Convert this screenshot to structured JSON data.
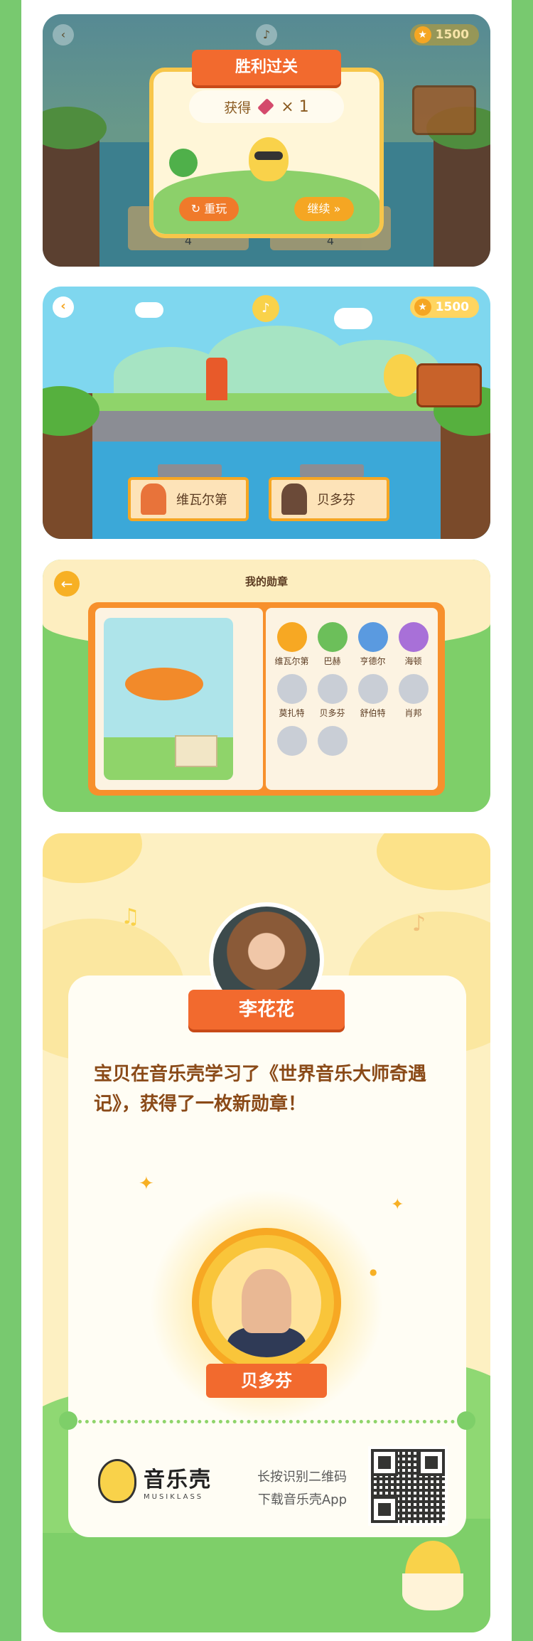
{
  "colors": {
    "page_green": "#78c96f",
    "accent_orange": "#f26a2e",
    "accent_yellow": "#f9d24a",
    "cream": "#fdf0c2",
    "text_brown": "#8a4a18"
  },
  "victory": {
    "ribbon_title": "胜利过关",
    "reward_label": "获得",
    "reward_icon": "gem-icon",
    "reward_count": "× 1",
    "replay_label": "重玩",
    "continue_label": "继续 »",
    "coins": "1500",
    "plate_left": "4",
    "plate_right": "4"
  },
  "game": {
    "coins": "1500",
    "answers": [
      "维瓦尔第",
      "贝多芬"
    ]
  },
  "medals": {
    "title": "我的勋章",
    "items": [
      {
        "name": "维瓦尔第",
        "earned": true,
        "color": "#f7a823"
      },
      {
        "name": "巴赫",
        "earned": true,
        "color": "#6cbf5a"
      },
      {
        "name": "亨德尔",
        "earned": true,
        "color": "#5a9ae0"
      },
      {
        "name": "海顿",
        "earned": true,
        "color": "#a870d8"
      },
      {
        "name": "莫扎特",
        "earned": false,
        "color": "#c9ced6"
      },
      {
        "name": "贝多芬",
        "earned": false,
        "color": "#c9ced6"
      },
      {
        "name": "舒伯特",
        "earned": false,
        "color": "#c9ced6"
      },
      {
        "name": "肖邦",
        "earned": false,
        "color": "#c9ced6"
      },
      {
        "name": "",
        "earned": false,
        "color": "#c9ced6"
      },
      {
        "name": "",
        "earned": false,
        "color": "#c9ced6"
      }
    ]
  },
  "share": {
    "user_name": "李花花",
    "message": "宝贝在音乐壳学习了《世界音乐大师奇遇记》，获得了一枚新勋章！",
    "medal_name": "贝多芬",
    "brand_cn": "音乐壳",
    "brand_en": "MUSIKLASS",
    "scan_line1": "长按识别二维码",
    "scan_line2": "下载音乐壳App"
  }
}
